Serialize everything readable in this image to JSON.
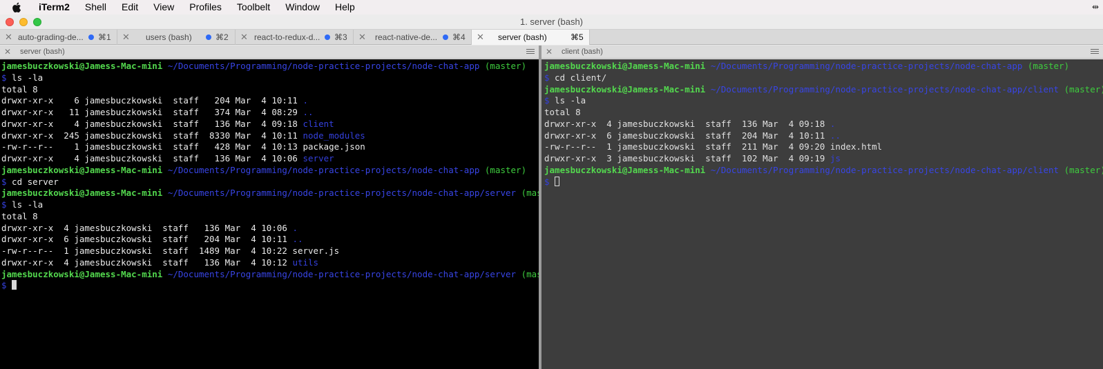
{
  "menubar": {
    "app_name": "iTerm2",
    "items": [
      "Shell",
      "Edit",
      "View",
      "Profiles",
      "Toolbelt",
      "Window",
      "Help"
    ]
  },
  "window": {
    "title": "1. server (bash)"
  },
  "tabs": [
    {
      "label": "auto-grading-de...",
      "shortcut": "⌘1",
      "active": false
    },
    {
      "label": "users (bash)",
      "shortcut": "⌘2",
      "active": false
    },
    {
      "label": "react-to-redux-d...",
      "shortcut": "⌘3",
      "active": false
    },
    {
      "label": "react-native-de...",
      "shortcut": "⌘4",
      "active": false
    },
    {
      "label": "server (bash)",
      "shortcut": "⌘5",
      "active": true
    }
  ],
  "left_pane": {
    "title": "server (bash)",
    "lines": [
      [
        {
          "t": "jamesbuczkowski@Jamess-Mac-mini",
          "c": "user"
        },
        {
          "t": " ",
          "c": "text"
        },
        {
          "t": "~/Documents/Programming/node-practice-projects/node-chat-app",
          "c": "path"
        },
        {
          "t": " ",
          "c": "text"
        },
        {
          "t": "(master)",
          "c": "branch"
        }
      ],
      [
        {
          "t": "$",
          "c": "prompt"
        },
        {
          "t": " ls -la",
          "c": "text"
        }
      ],
      [
        {
          "t": "total 8",
          "c": "text"
        }
      ],
      [
        {
          "t": "drwxr-xr-x    6 jamesbuczkowski  staff   204 Mar  4 10:11 ",
          "c": "text"
        },
        {
          "t": ".",
          "c": "dir"
        }
      ],
      [
        {
          "t": "drwxr-xr-x   11 jamesbuczkowski  staff   374 Mar  4 08:29 ",
          "c": "text"
        },
        {
          "t": "..",
          "c": "dir"
        }
      ],
      [
        {
          "t": "drwxr-xr-x    4 jamesbuczkowski  staff   136 Mar  4 09:18 ",
          "c": "text"
        },
        {
          "t": "client",
          "c": "dir"
        }
      ],
      [
        {
          "t": "drwxr-xr-x  245 jamesbuczkowski  staff  8330 Mar  4 10:11 ",
          "c": "text"
        },
        {
          "t": "node_modules",
          "c": "dir"
        }
      ],
      [
        {
          "t": "-rw-r--r--    1 jamesbuczkowski  staff   428 Mar  4 10:13 package.json",
          "c": "text"
        }
      ],
      [
        {
          "t": "drwxr-xr-x    4 jamesbuczkowski  staff   136 Mar  4 10:06 ",
          "c": "text"
        },
        {
          "t": "server",
          "c": "dir"
        }
      ],
      [
        {
          "t": "jamesbuczkowski@Jamess-Mac-mini",
          "c": "user"
        },
        {
          "t": " ",
          "c": "text"
        },
        {
          "t": "~/Documents/Programming/node-practice-projects/node-chat-app",
          "c": "path"
        },
        {
          "t": " ",
          "c": "text"
        },
        {
          "t": "(master)",
          "c": "branch"
        }
      ],
      [
        {
          "t": "$",
          "c": "prompt"
        },
        {
          "t": " cd server",
          "c": "text"
        }
      ],
      [
        {
          "t": "jamesbuczkowski@Jamess-Mac-mini",
          "c": "user"
        },
        {
          "t": " ",
          "c": "text"
        },
        {
          "t": "~/Documents/Programming/node-practice-projects/node-chat-app/server",
          "c": "path"
        },
        {
          "t": " ",
          "c": "text"
        },
        {
          "t": "(master)",
          "c": "branch"
        }
      ],
      [
        {
          "t": "$",
          "c": "prompt"
        },
        {
          "t": " ls -la",
          "c": "text"
        }
      ],
      [
        {
          "t": "total 8",
          "c": "text"
        }
      ],
      [
        {
          "t": "drwxr-xr-x  4 jamesbuczkowski  staff   136 Mar  4 10:06 ",
          "c": "text"
        },
        {
          "t": ".",
          "c": "dir"
        }
      ],
      [
        {
          "t": "drwxr-xr-x  6 jamesbuczkowski  staff   204 Mar  4 10:11 ",
          "c": "text"
        },
        {
          "t": "..",
          "c": "dir"
        }
      ],
      [
        {
          "t": "-rw-r--r--  1 jamesbuczkowski  staff  1489 Mar  4 10:22 server.js",
          "c": "text"
        }
      ],
      [
        {
          "t": "drwxr-xr-x  4 jamesbuczkowski  staff   136 Mar  4 10:12 ",
          "c": "text"
        },
        {
          "t": "utils",
          "c": "dir"
        }
      ],
      [
        {
          "t": "jamesbuczkowski@Jamess-Mac-mini",
          "c": "user"
        },
        {
          "t": " ",
          "c": "text"
        },
        {
          "t": "~/Documents/Programming/node-practice-projects/node-chat-app/server",
          "c": "path"
        },
        {
          "t": " ",
          "c": "text"
        },
        {
          "t": "(master)",
          "c": "branch"
        }
      ],
      [
        {
          "t": "$",
          "c": "prompt"
        },
        {
          "t": " ",
          "c": "text"
        },
        {
          "t": "",
          "c": "cursor"
        }
      ]
    ]
  },
  "right_pane": {
    "title": "client (bash)",
    "lines": [
      [
        {
          "t": "jamesbuczkowski@Jamess-Mac-mini",
          "c": "user"
        },
        {
          "t": " ",
          "c": "text"
        },
        {
          "t": "~/Documents/Programming/node-practice-projects/node-chat-app",
          "c": "path"
        },
        {
          "t": " ",
          "c": "text"
        },
        {
          "t": "(master)",
          "c": "branch"
        }
      ],
      [
        {
          "t": "$",
          "c": "prompt"
        },
        {
          "t": " cd client/",
          "c": "text"
        }
      ],
      [
        {
          "t": "jamesbuczkowski@Jamess-Mac-mini",
          "c": "user"
        },
        {
          "t": " ",
          "c": "text"
        },
        {
          "t": "~/Documents/Programming/node-practice-projects/node-chat-app/client",
          "c": "path"
        },
        {
          "t": " ",
          "c": "text"
        },
        {
          "t": "(master)",
          "c": "branch"
        }
      ],
      [
        {
          "t": "$",
          "c": "prompt"
        },
        {
          "t": " ls -la",
          "c": "text"
        }
      ],
      [
        {
          "t": "total 8",
          "c": "text"
        }
      ],
      [
        {
          "t": "drwxr-xr-x  4 jamesbuczkowski  staff  136 Mar  4 09:18 ",
          "c": "text"
        },
        {
          "t": ".",
          "c": "dir"
        }
      ],
      [
        {
          "t": "drwxr-xr-x  6 jamesbuczkowski  staff  204 Mar  4 10:11 ",
          "c": "text"
        },
        {
          "t": "..",
          "c": "dir"
        }
      ],
      [
        {
          "t": "-rw-r--r--  1 jamesbuczkowski  staff  211 Mar  4 09:20 index.html",
          "c": "text"
        }
      ],
      [
        {
          "t": "drwxr-xr-x  3 jamesbuczkowski  staff  102 Mar  4 09:19 ",
          "c": "text"
        },
        {
          "t": "js",
          "c": "dir"
        }
      ],
      [
        {
          "t": "jamesbuczkowski@Jamess-Mac-mini",
          "c": "user"
        },
        {
          "t": " ",
          "c": "text"
        },
        {
          "t": "~/Documents/Programming/node-practice-projects/node-chat-app/client",
          "c": "path"
        },
        {
          "t": " ",
          "c": "text"
        },
        {
          "t": "(master)",
          "c": "branch"
        }
      ],
      [
        {
          "t": "$",
          "c": "prompt"
        },
        {
          "t": " ",
          "c": "text"
        },
        {
          "t": "",
          "c": "cursor"
        }
      ]
    ]
  },
  "colors": {
    "user": "#53d84e",
    "path": "#3845e6",
    "branch": "#3ecc3e",
    "directory": "#3440dc",
    "left_background": "#000000",
    "right_background": "#3d3d3d",
    "tab_dot": "#2f6af6"
  },
  "icons": {
    "apple": "apple-icon",
    "corner": "resize-icon",
    "tab_close": "close-icon",
    "pane_menu": "hamburger-menu-icon"
  }
}
